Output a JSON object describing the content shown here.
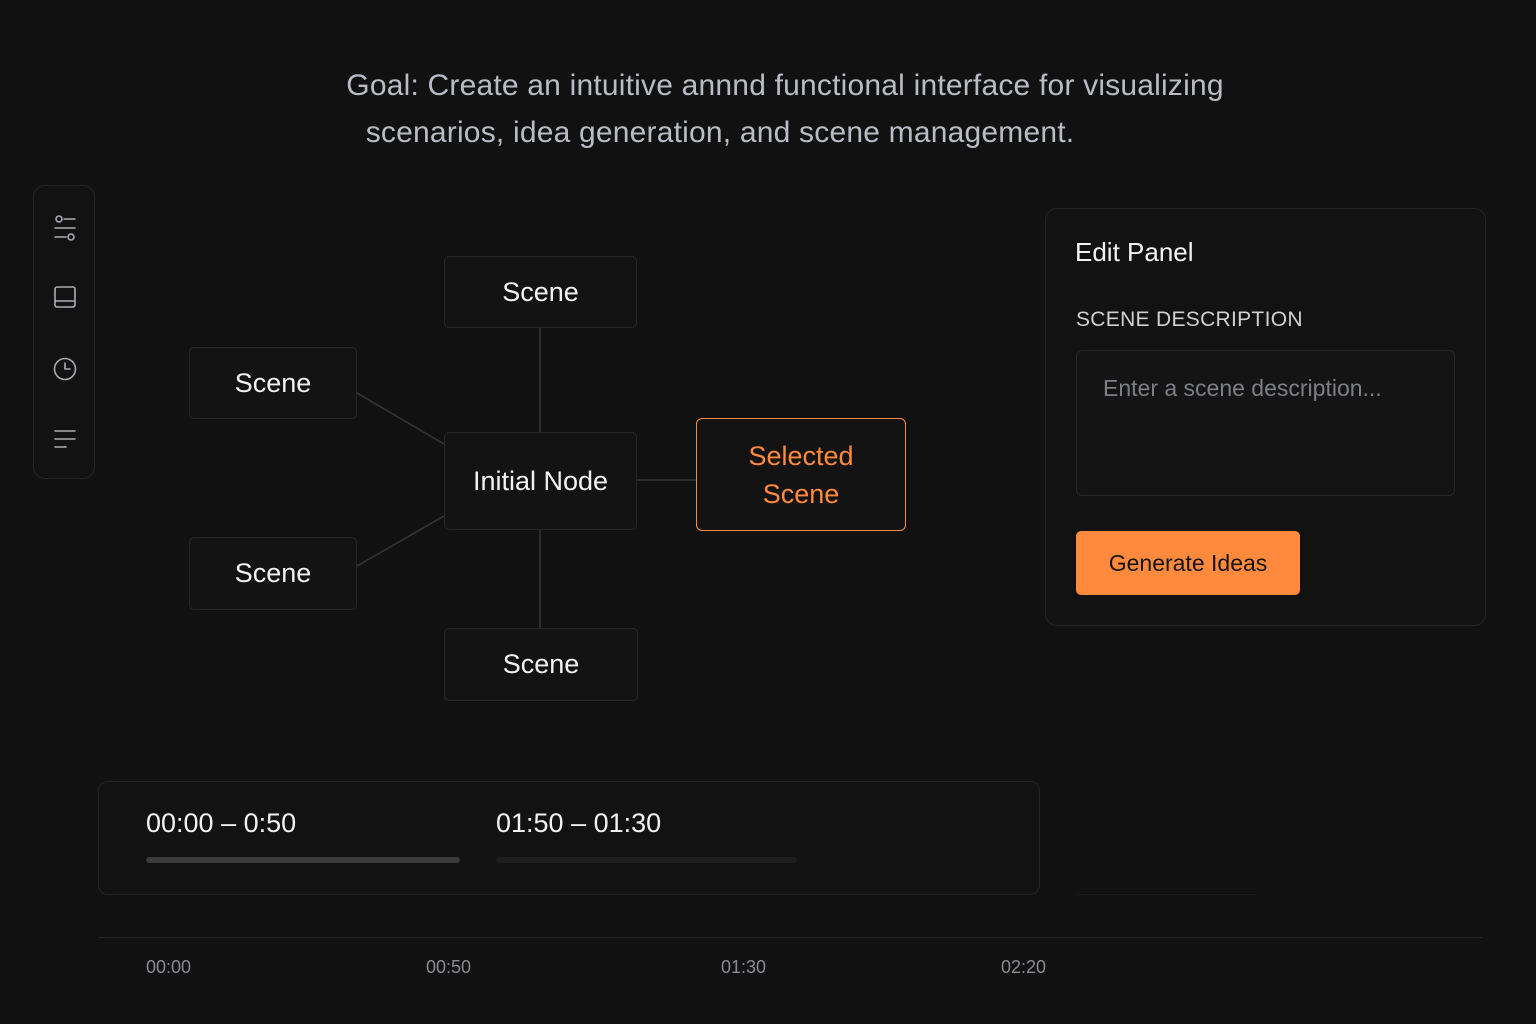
{
  "goal": {
    "line1": "Goal: Create an intuitive annnd functional interface for visualizing",
    "line2": "scenarios, idea generation, and scene management."
  },
  "toolbar": {
    "tools": [
      {
        "icon": "sliders-icon",
        "name": "adjustments"
      },
      {
        "icon": "panel-icon",
        "name": "layout"
      },
      {
        "icon": "clock-icon",
        "name": "history"
      },
      {
        "icon": "lines-icon",
        "name": "list"
      }
    ]
  },
  "graph": {
    "center": "Initial Node",
    "top": "Scene",
    "bottom": "Scene",
    "left_top": "Scene",
    "left_bottom": "Scene",
    "selected_line1": "Selected",
    "selected_line2": "Scene"
  },
  "edit_panel": {
    "title": "Edit Panel",
    "field_label": "SCENE DESCRIPTION",
    "description_value": "",
    "description_placeholder": "Enter a scene description...",
    "generate_label": "Generate Ideas"
  },
  "clips": [
    {
      "label": "00:00 – 0:50",
      "fill": 1.0
    },
    {
      "label": "01:50 – 01:30",
      "fill": 0.0
    }
  ],
  "ruler": {
    "ticks": [
      "00:00",
      "00:50",
      "01:30",
      "02:20"
    ]
  },
  "colors": {
    "accent": "#ff8a3d",
    "background": "#111111",
    "border": "#262626",
    "text": "#f2f2f2",
    "muted": "#8a8c92"
  }
}
